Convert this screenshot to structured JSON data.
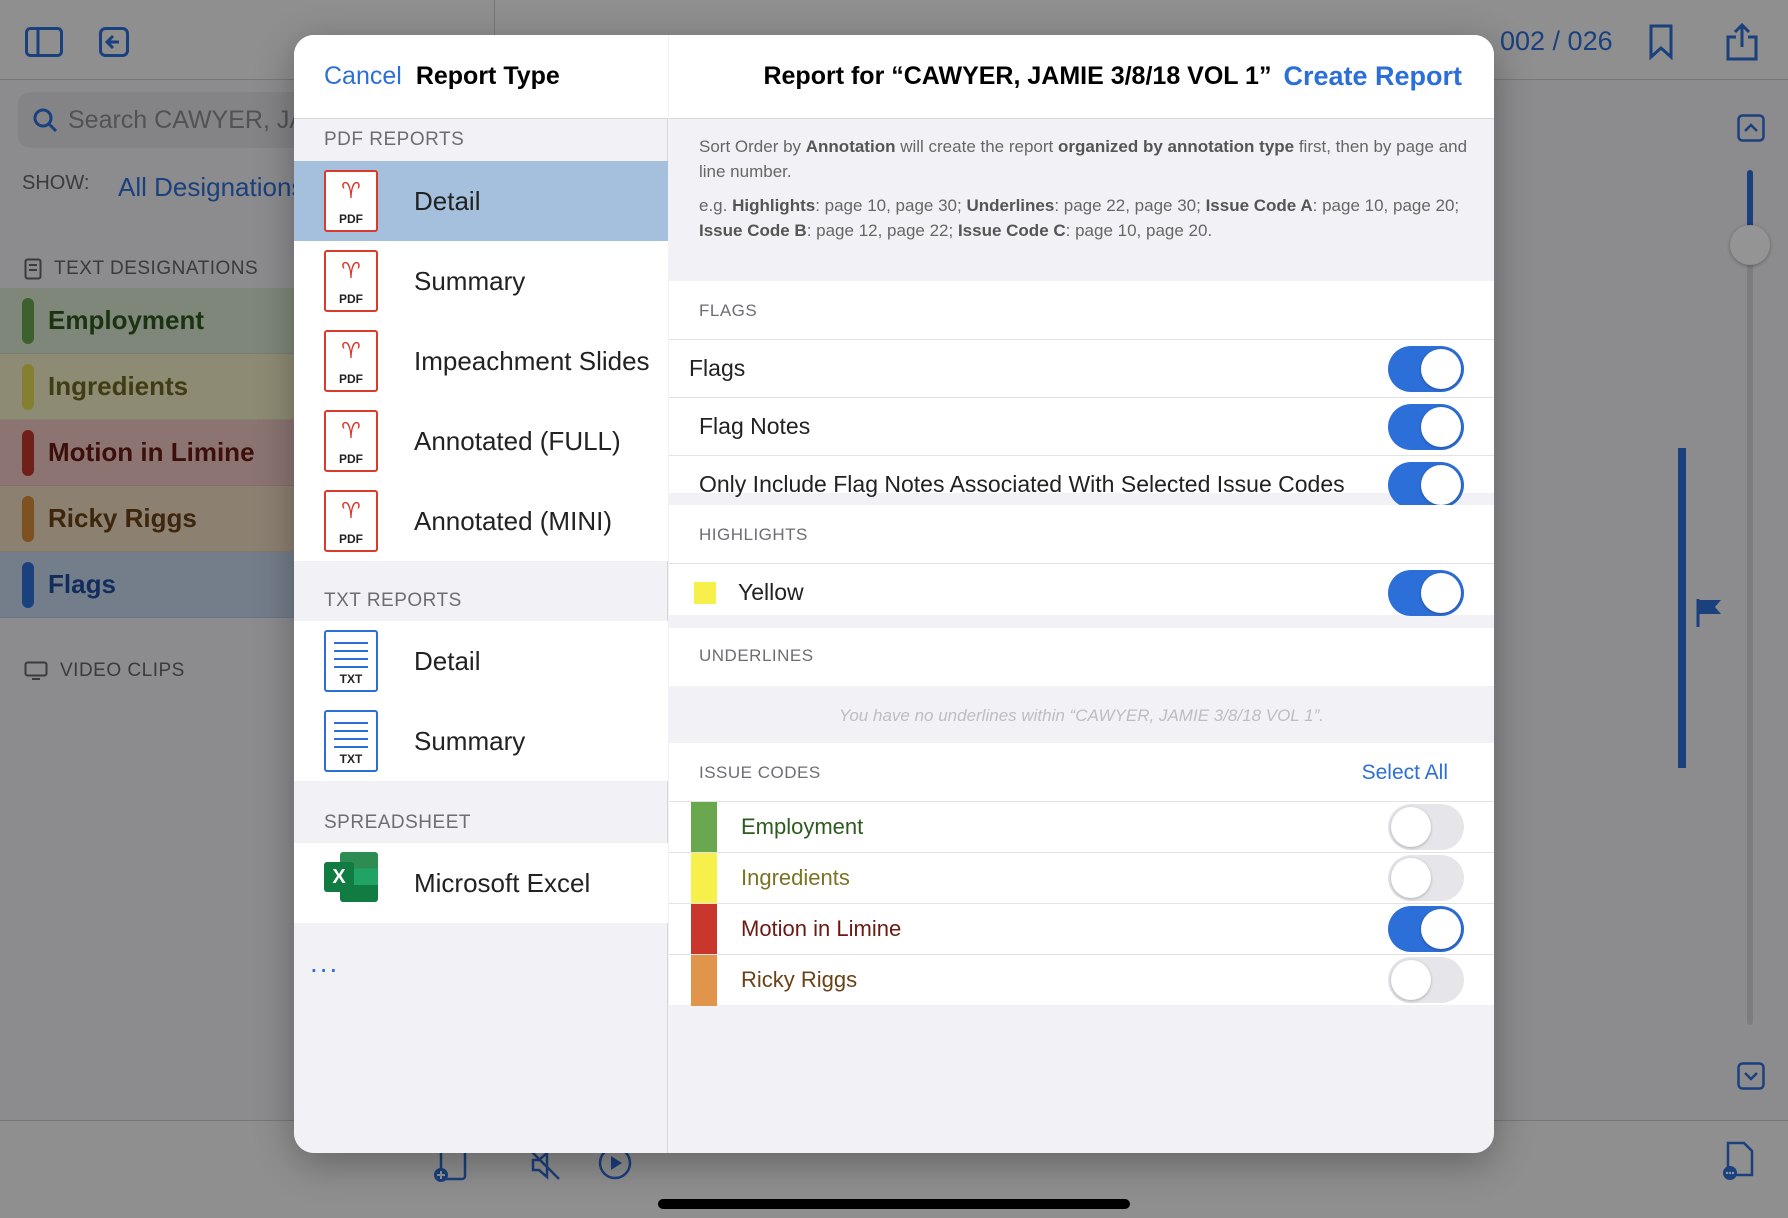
{
  "background": {
    "page_indicator": "002 / 026",
    "search_placeholder": "Search CAWYER, JA",
    "show_label": "SHOW:",
    "show_value": "All Designations",
    "text_designations_label": "TEXT DESIGNATIONS",
    "video_clips_label": "VIDEO CLIPS",
    "designations": [
      {
        "name": "Employment",
        "color": "#6aa84f",
        "bg": "#d9e8d2",
        "text": "#2e5a1f"
      },
      {
        "name": "Ingredients",
        "color": "#e6dd55",
        "bg": "#f4f0c8",
        "text": "#6e6a24"
      },
      {
        "name": "Motion in Limine",
        "color": "#c0392b",
        "bg": "#efc9c4",
        "text": "#6a1a12"
      },
      {
        "name": "Ricky Riggs",
        "color": "#d98c3a",
        "bg": "#f2dcc3",
        "text": "#6b4216"
      },
      {
        "name": "Flags",
        "color": "#2d6fd8",
        "bg": "#c8d8ee",
        "text": "#1f4fa1"
      }
    ]
  },
  "left": {
    "cancel": "Cancel",
    "title": "Report Type",
    "pdf_group": "PDF REPORTS",
    "pdf_items": [
      "Detail",
      "Summary",
      "Impeachment Slides",
      "Annotated (FULL)",
      "Annotated (MINI)"
    ],
    "txt_group": "TXT REPORTS",
    "txt_items": [
      "Detail",
      "Summary"
    ],
    "spreadsheet_group": "SPREADSHEET",
    "spreadsheet_items": [
      "Microsoft Excel"
    ],
    "more": "...",
    "pdf_icon_label": "PDF",
    "txt_icon_label": "TXT",
    "xls_icon_label": "X"
  },
  "right": {
    "title": "Report for “CAWYER, JAMIE 3/8/18 VOL 1”",
    "create": "Create Report",
    "info_1a": "Sort Order by ",
    "info_1b": "Annotation",
    "info_1c": " will create the report ",
    "info_1d": "organized by annotation type",
    "info_1e": " first, then by page and line number.",
    "info_2a": "e.g. ",
    "info_2b": "Highlights",
    "info_2c": ": page 10, page 30; ",
    "info_2d": "Underlines",
    "info_2e": ": page 22, page 30; ",
    "info_2f": "Issue Code A",
    "info_2g": ": page 10, page 20; ",
    "info_2h": "Issue Code B",
    "info_2i": ": page 12, page 22; ",
    "info_2j": "Issue Code C",
    "info_2k": ": page 10, page 20.",
    "flags_label": "FLAGS",
    "flags": [
      {
        "label": "Flags",
        "on": true
      },
      {
        "label": "Flag Notes",
        "on": true
      },
      {
        "label": "Only Include Flag Notes Associated With Selected Issue Codes",
        "on": true
      }
    ],
    "highlights_label": "HIGHLIGHTS",
    "highlight": {
      "label": "Yellow",
      "color": "#f7f04a",
      "on": true
    },
    "underlines_label": "UNDERLINES",
    "underlines_empty": "You have no underlines within “CAWYER, JAMIE 3/8/18 VOL 1”.",
    "issue_codes_label": "ISSUE CODES",
    "select_all": "Select All",
    "issue_codes": [
      {
        "label": "Employment",
        "color": "#6aa84f",
        "text": "#2e5a1f",
        "on": false
      },
      {
        "label": "Ingredients",
        "color": "#f7f04a",
        "text": "#7a7424",
        "on": false
      },
      {
        "label": "Motion in Limine",
        "color": "#c9372c",
        "text": "#6a1a12",
        "on": true
      },
      {
        "label": "Ricky Riggs",
        "color": "#e0954a",
        "text": "#6b4216",
        "on": false
      }
    ]
  }
}
